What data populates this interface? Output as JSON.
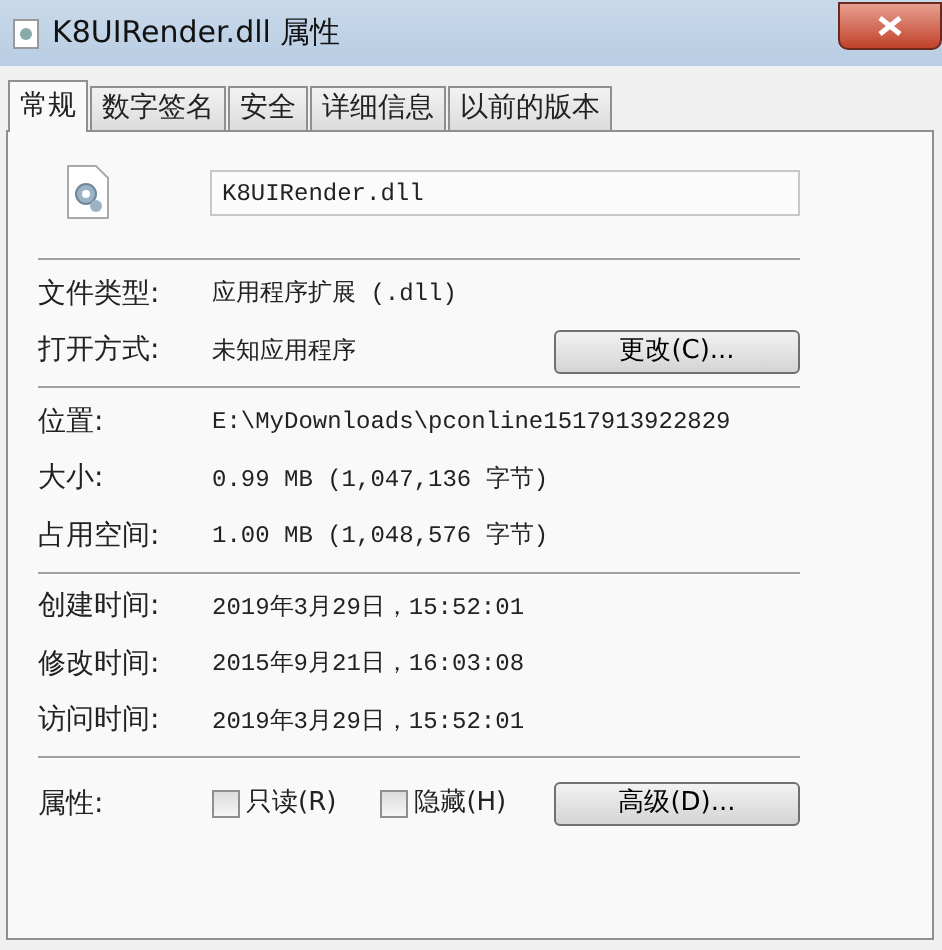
{
  "window": {
    "title": "K8UIRender.dll 属性"
  },
  "tabs": [
    {
      "label": "常规",
      "selected": true
    },
    {
      "label": "数字签名",
      "selected": false
    },
    {
      "label": "安全",
      "selected": false
    },
    {
      "label": "详细信息",
      "selected": false
    },
    {
      "label": "以前的版本",
      "selected": false
    }
  ],
  "file_name": {
    "value": "K8UIRender.dll"
  },
  "groups": [
    [
      {
        "label": "文件类型:",
        "value": "应用程序扩展 (.dll)"
      },
      {
        "label": "打开方式:",
        "value": "未知应用程序",
        "button": "更改(C)..."
      }
    ],
    [
      {
        "label": "位置:",
        "value": "E:\\MyDownloads\\pconline1517913922829"
      },
      {
        "label": "大小:",
        "value": "0.99 MB (1,047,136 字节)"
      },
      {
        "label": "占用空间:",
        "value": "1.00 MB (1,048,576 字节)"
      }
    ],
    [
      {
        "label": "创建时间:",
        "value": "2019年3月29日，15:52:01"
      },
      {
        "label": "修改时间:",
        "value": "2015年9月21日，16:03:08"
      },
      {
        "label": "访问时间:",
        "value": "2019年3月29日，15:52:01"
      }
    ]
  ],
  "attributes": {
    "label": "属性:",
    "checkboxes": [
      {
        "label": "只读(R)",
        "checked": false
      },
      {
        "label": "隐藏(H)",
        "checked": false
      }
    ],
    "button": "高级(D)..."
  }
}
